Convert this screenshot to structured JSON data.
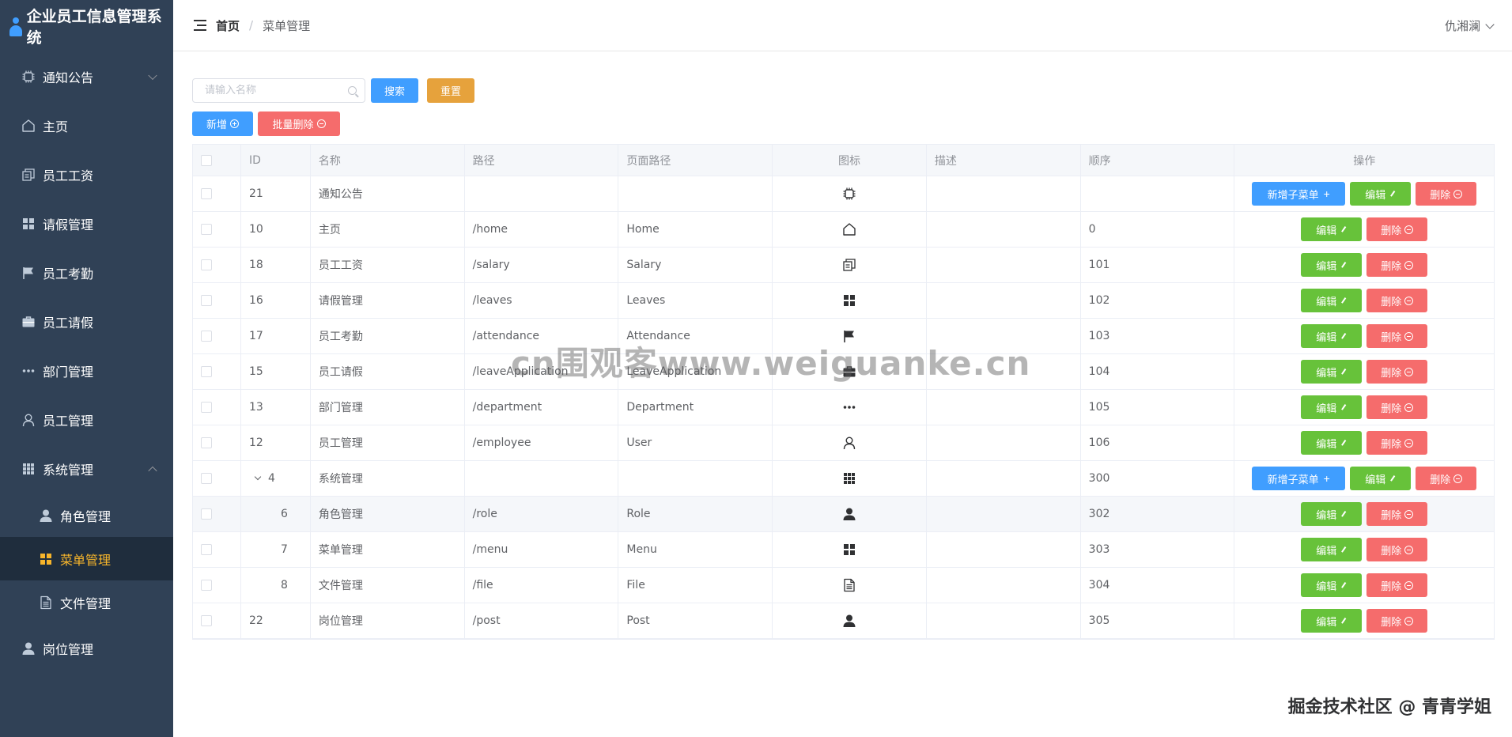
{
  "app": {
    "title": "企业员工信息管理系统"
  },
  "sidebar": {
    "items": [
      {
        "label": "通知公告",
        "icon": "chip-icon",
        "arrow": "down"
      },
      {
        "label": "主页",
        "icon": "home-icon"
      },
      {
        "label": "员工工资",
        "icon": "copy-document-icon"
      },
      {
        "label": "请假管理",
        "icon": "grid-icon"
      },
      {
        "label": "员工考勤",
        "icon": "flag-icon"
      },
      {
        "label": "员工请假",
        "icon": "briefcase-icon"
      },
      {
        "label": "部门管理",
        "icon": "more-dots-icon"
      },
      {
        "label": "员工管理",
        "icon": "user-icon"
      },
      {
        "label": "系统管理",
        "icon": "menu-grid-icon",
        "arrow": "up"
      }
    ],
    "sub_items": [
      {
        "label": "角色管理",
        "icon": "user-solid-icon"
      },
      {
        "label": "菜单管理",
        "icon": "menu-grid-icon",
        "active": true
      },
      {
        "label": "文件管理",
        "icon": "document-icon"
      }
    ],
    "last_item": {
      "label": "岗位管理",
      "icon": "user-solid-icon"
    },
    "active_color": "#f7b52b",
    "bg_color": "#304156"
  },
  "header": {
    "breadcrumb_home": "首页",
    "breadcrumb_sep": "/",
    "breadcrumb_current": "菜单管理",
    "user_name": "仇湘澜"
  },
  "toolbar": {
    "search_placeholder": "请输入名称",
    "search_label": "搜索",
    "reset_label": "重置",
    "add_label": "新增",
    "batch_delete_label": "批量删除"
  },
  "table": {
    "headers": [
      "ID",
      "名称",
      "路径",
      "页面路径",
      "图标",
      "描述",
      "顺序",
      "操作"
    ],
    "add_child_label": "新增子菜单",
    "edit_label": "编辑",
    "delete_label": "删除",
    "rows": [
      {
        "id": "21",
        "name": "通知公告",
        "path": "",
        "page": "",
        "icon": "chip",
        "desc": "",
        "order": "",
        "has_child": true
      },
      {
        "id": "10",
        "name": "主页",
        "path": "/home",
        "page": "Home",
        "icon": "home",
        "desc": "",
        "order": "0"
      },
      {
        "id": "18",
        "name": "员工工资",
        "path": "/salary",
        "page": "Salary",
        "icon": "copy",
        "desc": "",
        "order": "101"
      },
      {
        "id": "16",
        "name": "请假管理",
        "path": "/leaves",
        "page": "Leaves",
        "icon": "grid",
        "desc": "",
        "order": "102"
      },
      {
        "id": "17",
        "name": "员工考勤",
        "path": "/attendance",
        "page": "Attendance",
        "icon": "flag",
        "desc": "",
        "order": "103"
      },
      {
        "id": "15",
        "name": "员工请假",
        "path": "/leaveApplication",
        "page": "LeaveApplication",
        "icon": "briefcase",
        "desc": "",
        "order": "104"
      },
      {
        "id": "13",
        "name": "部门管理",
        "path": "/department",
        "page": "Department",
        "icon": "dots",
        "desc": "",
        "order": "105"
      },
      {
        "id": "12",
        "name": "员工管理",
        "path": "/employee",
        "page": "User",
        "icon": "user",
        "desc": "",
        "order": "106"
      },
      {
        "id": "4",
        "name": "系统管理",
        "path": "",
        "page": "",
        "icon": "menu",
        "desc": "",
        "order": "300",
        "has_child": true,
        "expanded": true
      },
      {
        "id": "6",
        "name": "角色管理",
        "path": "/role",
        "page": "Role",
        "icon": "usersolid",
        "desc": "",
        "order": "302",
        "child": true,
        "highlight": true
      },
      {
        "id": "7",
        "name": "菜单管理",
        "path": "/menu",
        "page": "Menu",
        "icon": "grid",
        "desc": "",
        "order": "303",
        "child": true
      },
      {
        "id": "8",
        "name": "文件管理",
        "path": "/file",
        "page": "File",
        "icon": "doc",
        "desc": "",
        "order": "304",
        "child": true
      },
      {
        "id": "22",
        "name": "岗位管理",
        "path": "/post",
        "page": "Post",
        "icon": "usersolid",
        "desc": "",
        "order": "305"
      }
    ]
  },
  "watermark": "cn围观客www.weiguanke.cn",
  "footer_mark": "掘金技术社区 @ 青青学姐",
  "colors": {
    "primary": "#409eff",
    "success": "#67c23a",
    "danger": "#f56c6c",
    "warning": "#e6a23c"
  }
}
